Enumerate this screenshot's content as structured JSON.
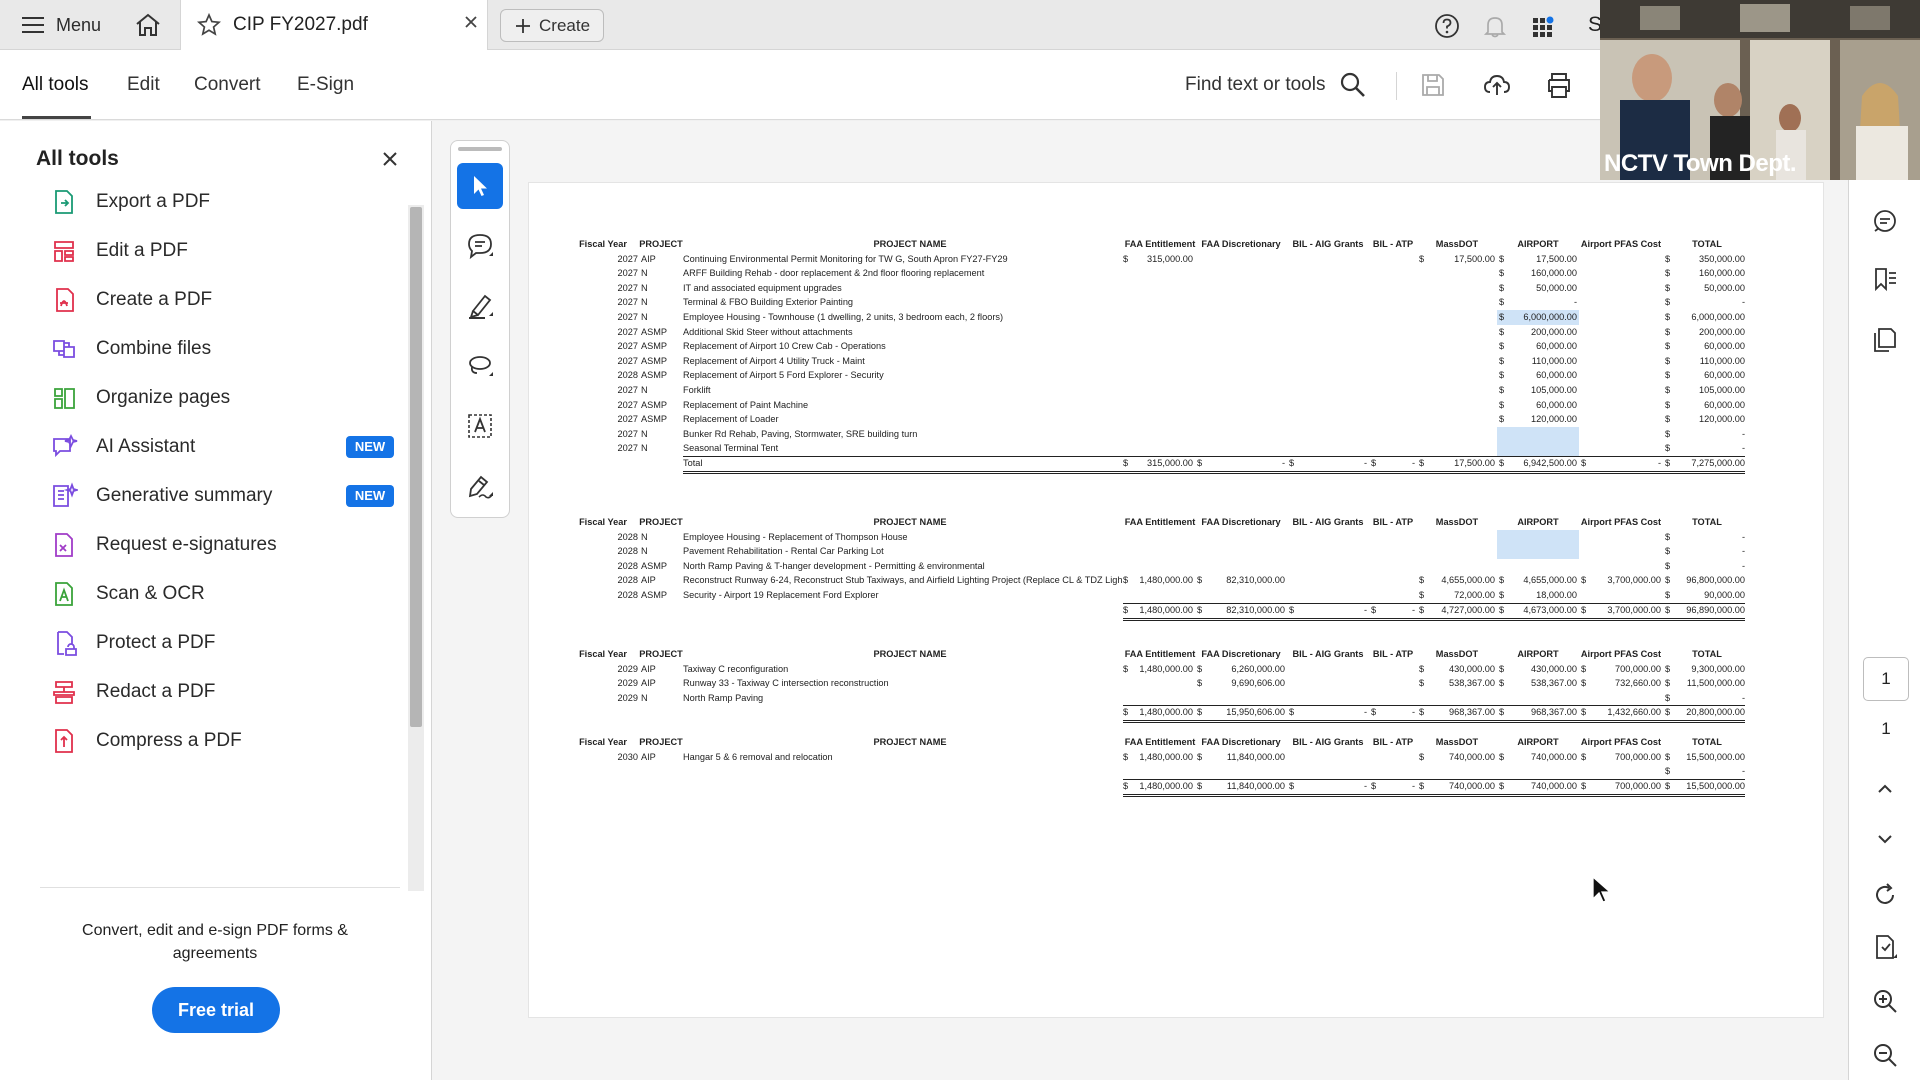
{
  "topbar": {
    "menu_label": "Menu",
    "tab_title": "CIP FY2027.pdf",
    "create_label": "Create",
    "profile_initial_partial": "S"
  },
  "toolbar": {
    "tabs": [
      "All tools",
      "Edit",
      "Convert",
      "E-Sign"
    ],
    "active_tab": "All tools",
    "find_label": "Find text or tools"
  },
  "sidebar": {
    "title": "All tools",
    "tools": [
      {
        "label": "Export a PDF",
        "icon": "export-pdf-icon",
        "color": "#1a9a74"
      },
      {
        "label": "Edit a PDF",
        "icon": "edit-pdf-icon",
        "color": "#e0304c"
      },
      {
        "label": "Create a PDF",
        "icon": "create-pdf-icon",
        "color": "#e0304c"
      },
      {
        "label": "Combine files",
        "icon": "combine-files-icon",
        "color": "#7b4de0"
      },
      {
        "label": "Organize pages",
        "icon": "organize-pages-icon",
        "color": "#3aa33a"
      },
      {
        "label": "AI Assistant",
        "icon": "ai-assistant-icon",
        "color": "#7b4de0",
        "badge": "NEW"
      },
      {
        "label": "Generative summary",
        "icon": "generative-summary-icon",
        "color": "#7b4de0",
        "badge": "NEW"
      },
      {
        "label": "Request e-signatures",
        "icon": "request-esign-icon",
        "color": "#a03cc8"
      },
      {
        "label": "Scan & OCR",
        "icon": "scan-ocr-icon",
        "color": "#3aa33a"
      },
      {
        "label": "Protect a PDF",
        "icon": "protect-pdf-icon",
        "color": "#7b4de0"
      },
      {
        "label": "Redact a PDF",
        "icon": "redact-pdf-icon",
        "color": "#e0304c"
      },
      {
        "label": "Compress a PDF",
        "icon": "compress-pdf-icon",
        "color": "#e0304c"
      }
    ],
    "promo_text": "Convert, edit and e-sign PDF forms & agreements",
    "trial_label": "Free trial"
  },
  "page_nav": {
    "current": "1",
    "total": "1"
  },
  "video": {
    "caption": "NCTV Town Dept."
  },
  "document": {
    "headers": [
      "Fiscal Year",
      "PROJECT",
      "PROJECT NAME",
      "FAA Entitlement",
      "FAA Discretionary",
      "BIL - AIG Grants",
      "BIL - ATP",
      "MassDOT",
      "AIRPORT",
      "Airport PFAS Cost",
      "TOTAL"
    ],
    "sections": [
      {
        "rows": [
          [
            "2027",
            "AIP",
            "Continuing Environmental Permit Monitoring for TW G, South Apron FY27-FY29",
            "$ 315,000.00",
            "",
            "",
            "",
            "$ 17,500.00",
            "$ 17,500.00",
            "",
            "$ 350,000.00"
          ],
          [
            "2027",
            "N",
            "ARFF Building Rehab - door replacement & 2nd floor flooring replacement",
            "",
            "",
            "",
            "",
            "",
            "$ 160,000.00",
            "",
            "$ 160,000.00"
          ],
          [
            "2027",
            "N",
            "IT and associated equipment upgrades",
            "",
            "",
            "",
            "",
            "",
            "$ 50,000.00",
            "",
            "$ 50,000.00"
          ],
          [
            "2027",
            "N",
            "Terminal & FBO Building Exterior Painting",
            "",
            "",
            "",
            "",
            "",
            "$ -",
            "",
            "$ -"
          ],
          [
            "2027",
            "N",
            "Employee Housing - Townhouse (1 dwelling, 2 units, 3 bedroom each, 2 floors)",
            "",
            "",
            "",
            "",
            "",
            "$ 6,000,000.00",
            "",
            "$ 6,000,000.00"
          ],
          [
            "2027",
            "ASMP",
            "Additional Skid Steer without attachments",
            "",
            "",
            "",
            "",
            "",
            "$ 200,000.00",
            "",
            "$ 200,000.00"
          ],
          [
            "2027",
            "ASMP",
            "Replacement of Airport 10 Crew Cab - Operations",
            "",
            "",
            "",
            "",
            "",
            "$ 60,000.00",
            "",
            "$ 60,000.00"
          ],
          [
            "2027",
            "ASMP",
            "Replacement of Airport 4 Utility Truck - Maint",
            "",
            "",
            "",
            "",
            "",
            "$ 110,000.00",
            "",
            "$ 110,000.00"
          ],
          [
            "2028",
            "ASMP",
            "Replacement of Airport 5 Ford Explorer - Security",
            "",
            "",
            "",
            "",
            "",
            "$ 60,000.00",
            "",
            "$ 60,000.00"
          ],
          [
            "2027",
            "N",
            "Forklift",
            "",
            "",
            "",
            "",
            "",
            "$ 105,000.00",
            "",
            "$ 105,000.00"
          ],
          [
            "2027",
            "ASMP",
            "Replacement of Paint Machine",
            "",
            "",
            "",
            "",
            "",
            "$ 60,000.00",
            "",
            "$ 60,000.00"
          ],
          [
            "2027",
            "ASMP",
            "Replacement of Loader",
            "",
            "",
            "",
            "",
            "",
            "$ 120,000.00",
            "",
            "$ 120,000.00"
          ],
          [
            "2027",
            "N",
            "Bunker Rd Rehab, Paving, Stormwater, SRE building turn",
            "",
            "",
            "",
            "",
            "",
            "",
            "",
            "$ -"
          ],
          [
            "2027",
            "N",
            "Seasonal Terminal Tent",
            "",
            "",
            "",
            "",
            "",
            "",
            "",
            "$ -"
          ]
        ],
        "total": [
          "",
          "",
          "Total",
          "$ 315,000.00",
          "$ -",
          "$ -",
          "$ -",
          "$ 17,500.00",
          "$ 6,942,500.00",
          "$ -",
          "$ 7,275,000.00"
        ]
      },
      {
        "rows": [
          [
            "2028",
            "N",
            "Employee Housing - Replacement of Thompson House",
            "",
            "",
            "",
            "",
            "",
            "",
            "",
            "$ -"
          ],
          [
            "2028",
            "N",
            "Pavement Rehabilitation - Rental Car Parking Lot",
            "",
            "",
            "",
            "",
            "",
            "",
            "",
            "$ -"
          ],
          [
            "2028",
            "ASMP",
            "North Ramp Paving & T-hanger development - Permitting & environmental",
            "",
            "",
            "",
            "",
            "",
            "",
            "",
            "$ -"
          ],
          [
            "2028",
            "AIP",
            "Reconstruct Runway 6-24, Reconstruct Stub Taxiways, and Airfield Lighting Project (Replace CL & TDZ Ligh",
            "$ 1,480,000.00",
            "$ 82,310,000.00",
            "",
            "",
            "$ 4,655,000.00",
            "$ 4,655,000.00",
            "$ 3,700,000.00",
            "$ 96,800,000.00"
          ],
          [
            "2028",
            "ASMP",
            "Security - Airport 19 Replacement Ford Explorer",
            "",
            "",
            "",
            "",
            "$ 72,000.00",
            "$ 18,000.00",
            "",
            "$ 90,000.00"
          ]
        ],
        "total": [
          "",
          "",
          "",
          "$ 1,480,000.00",
          "$ 82,310,000.00",
          "$ -",
          "$ -",
          "$ 4,727,000.00",
          "$ 4,673,000.00",
          "$ 3,700,000.00",
          "$ 96,890,000.00"
        ]
      },
      {
        "rows": [
          [
            "2029",
            "AIP",
            "Taxiway C reconfiguration",
            "$ 1,480,000.00",
            "$ 6,260,000.00",
            "",
            "",
            "$ 430,000.00",
            "$ 430,000.00",
            "$ 700,000.00",
            "$ 9,300,000.00"
          ],
          [
            "2029",
            "AIP",
            "Runway 33 - Taxiway C intersection reconstruction",
            "",
            "$ 9,690,606.00",
            "",
            "",
            "$ 538,367.00",
            "$ 538,367.00",
            "$ 732,660.00",
            "$ 11,500,000.00"
          ],
          [
            "2029",
            "N",
            "North Ramp Paving",
            "",
            "",
            "",
            "",
            "",
            "",
            "",
            "$ -"
          ]
        ],
        "total": [
          "",
          "",
          "",
          "$ 1,480,000.00",
          "$ 15,950,606.00",
          "$ -",
          "$ -",
          "$ 968,367.00",
          "$ 968,367.00",
          "$ 1,432,660.00",
          "$ 20,800,000.00"
        ]
      },
      {
        "rows": [
          [
            "2030",
            "AIP",
            "Hangar 5 & 6 removal and relocation",
            "$ 1,480,000.00",
            "$ 11,840,000.00",
            "",
            "",
            "$ 740,000.00",
            "$ 740,000.00",
            "$ 700,000.00",
            "$ 15,500,000.00"
          ],
          [
            "",
            "",
            "",
            "",
            "",
            "",
            "",
            "",
            "",
            "",
            "$ -"
          ]
        ],
        "total": [
          "",
          "",
          "",
          "$ 1,480,000.00",
          "$ 11,840,000.00",
          "$ -",
          "$ -",
          "$ 740,000.00",
          "$ 740,000.00",
          "$ 700,000.00",
          "$ 15,500,000.00"
        ]
      }
    ]
  }
}
